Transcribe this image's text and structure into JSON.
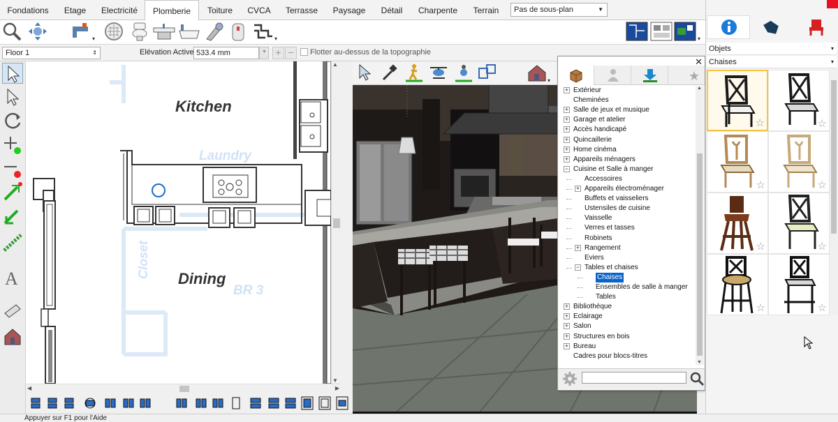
{
  "tabs": [
    {
      "label": "Fondations",
      "active": false
    },
    {
      "label": "Etage",
      "active": false
    },
    {
      "label": "Electricité",
      "active": false
    },
    {
      "label": "Plomberie",
      "active": true
    },
    {
      "label": "Toiture",
      "active": false
    },
    {
      "label": "CVCA",
      "active": false
    },
    {
      "label": "Terrasse",
      "active": false
    },
    {
      "label": "Paysage",
      "active": false
    },
    {
      "label": "Détail",
      "active": false
    },
    {
      "label": "Charpente",
      "active": false
    },
    {
      "label": "Terrain",
      "active": false
    }
  ],
  "subplan": {
    "value": "Pas de sous-plan"
  },
  "options": {
    "floor": "Floor 1",
    "elevation_label": "Elévation Active:",
    "elevation_value": "533.4 mm",
    "float_label": "Flotter au-dessus de la topographie"
  },
  "plan": {
    "rooms": {
      "kitchen": "Kitchen",
      "laundry": "Laundry",
      "dining": "Dining",
      "closet": "Closet",
      "br3": "BR 3"
    }
  },
  "library": {
    "tree": [
      {
        "label": "Extérieur",
        "level": 0,
        "expander": "+"
      },
      {
        "label": "Cheminées",
        "level": 0,
        "expander": ""
      },
      {
        "label": "Salle de jeux et musique",
        "level": 0,
        "expander": "+"
      },
      {
        "label": "Garage et atelier",
        "level": 0,
        "expander": "+"
      },
      {
        "label": "Accès handicapé",
        "level": 0,
        "expander": "+"
      },
      {
        "label": "Quincaillerie",
        "level": 0,
        "expander": "+"
      },
      {
        "label": "Home cinéma",
        "level": 0,
        "expander": "+"
      },
      {
        "label": "Appareils ménagers",
        "level": 0,
        "expander": "+"
      },
      {
        "label": "Cuisine et Salle à manger",
        "level": 0,
        "expander": "−"
      },
      {
        "label": "Accessoires",
        "level": 1,
        "expander": ""
      },
      {
        "label": "Appareils électroménager",
        "level": 1,
        "expander": "+"
      },
      {
        "label": "Buffets et vaisseliers",
        "level": 1,
        "expander": ""
      },
      {
        "label": "Ustensiles de cuisine",
        "level": 1,
        "expander": ""
      },
      {
        "label": "Vaisselle",
        "level": 1,
        "expander": ""
      },
      {
        "label": "Verres et tasses",
        "level": 1,
        "expander": ""
      },
      {
        "label": "Robinets",
        "level": 1,
        "expander": ""
      },
      {
        "label": "Rangement",
        "level": 1,
        "expander": "+"
      },
      {
        "label": "Eviers",
        "level": 1,
        "expander": ""
      },
      {
        "label": "Tables et chaises",
        "level": 1,
        "expander": "−"
      },
      {
        "label": "Chaises",
        "level": 2,
        "expander": "",
        "selected": true
      },
      {
        "label": "Ensembles de salle à manger",
        "level": 2,
        "expander": ""
      },
      {
        "label": "Tables",
        "level": 2,
        "expander": ""
      },
      {
        "label": "Bibliothèque",
        "level": 0,
        "expander": "+"
      },
      {
        "label": "Eclairage",
        "level": 0,
        "expander": "+"
      },
      {
        "label": "Salon",
        "level": 0,
        "expander": "+"
      },
      {
        "label": "Structures en bois",
        "level": 0,
        "expander": "+"
      },
      {
        "label": "Bureau",
        "level": 0,
        "expander": "+"
      },
      {
        "label": "Cadres pour blocs-titres",
        "level": 0,
        "expander": ""
      }
    ],
    "search_placeholder": ""
  },
  "right_panel": {
    "objects_label": "Objets",
    "category_label": "Chaises",
    "items": [
      {
        "name": "chair-lattice-black-white-seat",
        "selected": true
      },
      {
        "name": "chair-lattice-black-grey-seat",
        "selected": false
      },
      {
        "name": "chair-wood-cream-seat",
        "selected": false
      },
      {
        "name": "chair-wood-light-cream-seat",
        "selected": false
      },
      {
        "name": "high-chair-wood",
        "selected": false
      },
      {
        "name": "chair-lattice-green-seat",
        "selected": false
      },
      {
        "name": "bar-stool-round-seat",
        "selected": false
      },
      {
        "name": "bar-stool-square-seat",
        "selected": false
      }
    ]
  },
  "status": {
    "text": "Appuyer sur F1 pour l'Aide"
  },
  "colors": {
    "accent": "#0a64c8",
    "plan_fill": "#dce9f7",
    "selected_border": "#f4c542"
  }
}
